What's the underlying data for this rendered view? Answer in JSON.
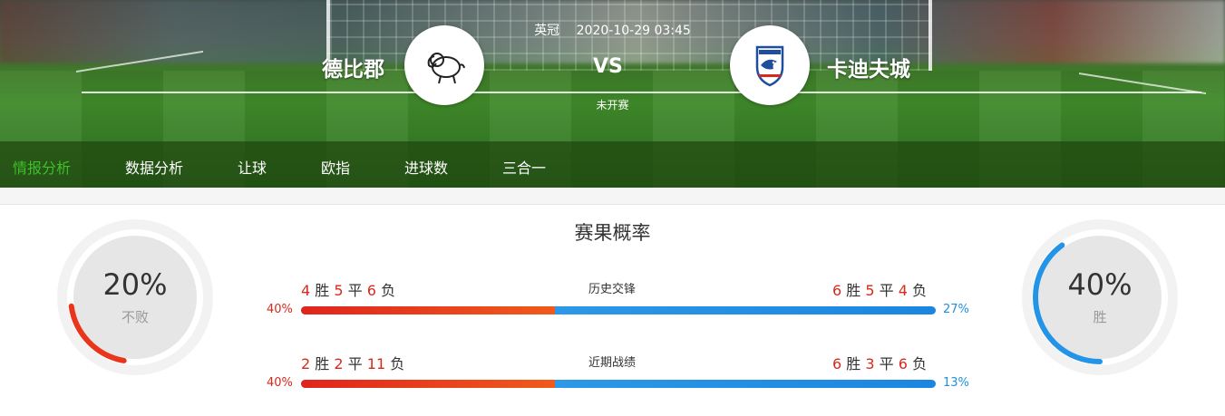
{
  "match": {
    "league": "英冠",
    "datetime": "2020-10-29 03:45",
    "vs": "VS",
    "status": "未开赛",
    "home_team": "德比郡",
    "away_team": "卡迪夫城"
  },
  "tabs": [
    "情报分析",
    "数据分析",
    "让球",
    "欧指",
    "进球数",
    "三合一"
  ],
  "active_tab": "情报分析",
  "section_title": "赛果概率",
  "left_ring": {
    "percent": "20%",
    "label": "不败",
    "value": 0.2,
    "color": "#e8351c"
  },
  "right_ring": {
    "percent": "40%",
    "label": "胜",
    "value": 0.4,
    "color": "#2494e6"
  },
  "rows": [
    {
      "title": "历史交锋",
      "home": {
        "w": "4",
        "d": "5",
        "l": "6"
      },
      "away": {
        "w": "6",
        "d": "5",
        "l": "4"
      },
      "home_pct": "40%",
      "away_pct": "27%",
      "home_share": 0.4
    },
    {
      "title": "近期战绩",
      "home": {
        "w": "2",
        "d": "2",
        "l": "11"
      },
      "away": {
        "w": "6",
        "d": "3",
        "l": "6"
      },
      "home_pct": "40%",
      "away_pct": "13%",
      "home_share": 0.4
    }
  ],
  "labels": {
    "win": "胜",
    "draw": "平",
    "loss": "负"
  },
  "colors": {
    "accent_green": "#3fbf2a",
    "home_red": "#d9291c",
    "away_blue": "#1e90e0"
  },
  "icons": {
    "home_logo": "derby-ram-crest-icon",
    "away_logo": "cardiff-bluebird-crest-icon"
  }
}
